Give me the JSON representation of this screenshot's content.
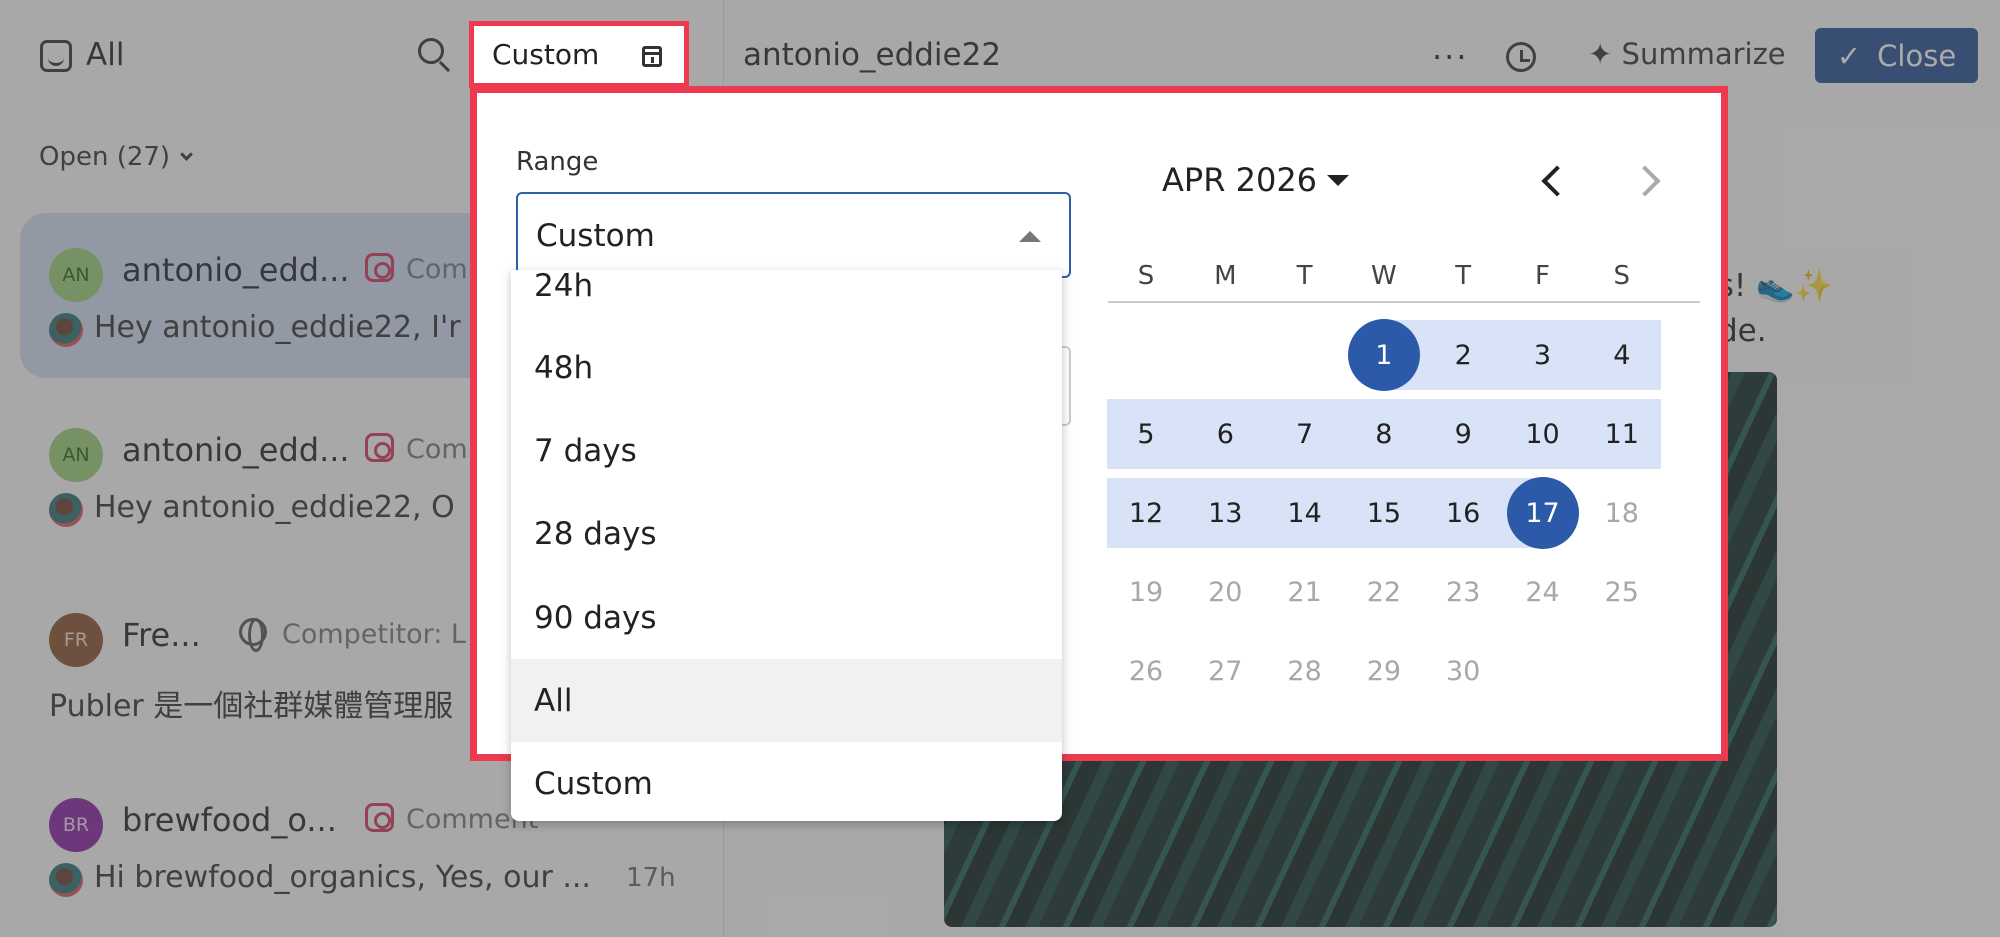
{
  "left": {
    "all_label": "All",
    "open_filter": "Open (27)",
    "conversations": [
      {
        "initials": "AN",
        "name": "antonio_edd...",
        "channel": "Com",
        "snippet": "Hey antonio_eddie22, I'r"
      },
      {
        "initials": "AN",
        "name": "antonio_edd...",
        "channel": "Com",
        "snippet": "Hey antonio_eddie22, O"
      },
      {
        "initials": "FR",
        "name": "Fre...",
        "channel": "Competitor: L",
        "snippet": "Publer 是一個社群媒體管理服"
      },
      {
        "initials": "BR",
        "name": "brewfood_o...",
        "channel": "Comment",
        "snippet": "Hi brewfood_organics, Yes, our ...",
        "time": "17h"
      }
    ]
  },
  "header": {
    "title": "antonio_eddie22",
    "more": "···",
    "summarize": "Summarize",
    "close": "Close"
  },
  "right_text": {
    "line1": "rs! 👟✨",
    "line2": "de."
  },
  "date_filter": {
    "trigger_label": "Custom",
    "range_label": "Range",
    "selected": "Custom",
    "options": [
      "24h",
      "48h",
      "7 days",
      "28 days",
      "90 days",
      "All",
      "Custom"
    ],
    "highlighted_option": "All",
    "calendar": {
      "month_label": "APR 2026",
      "weekdays": [
        "S",
        "M",
        "T",
        "W",
        "T",
        "F",
        "S"
      ],
      "weeks": [
        [
          "",
          "",
          "",
          "1",
          "2",
          "3",
          "4"
        ],
        [
          "5",
          "6",
          "7",
          "8",
          "9",
          "10",
          "11"
        ],
        [
          "12",
          "13",
          "14",
          "15",
          "16",
          "17",
          "18"
        ],
        [
          "19",
          "20",
          "21",
          "22",
          "23",
          "24",
          "25"
        ],
        [
          "26",
          "27",
          "28",
          "29",
          "30",
          "",
          ""
        ]
      ],
      "range_start": 1,
      "range_end": 17,
      "last_selectable_day": 17
    }
  },
  "colors": {
    "highlight_border": "#ee3a4e",
    "accent": "#2c5aa8",
    "range_fill": "#d8e3f7"
  }
}
